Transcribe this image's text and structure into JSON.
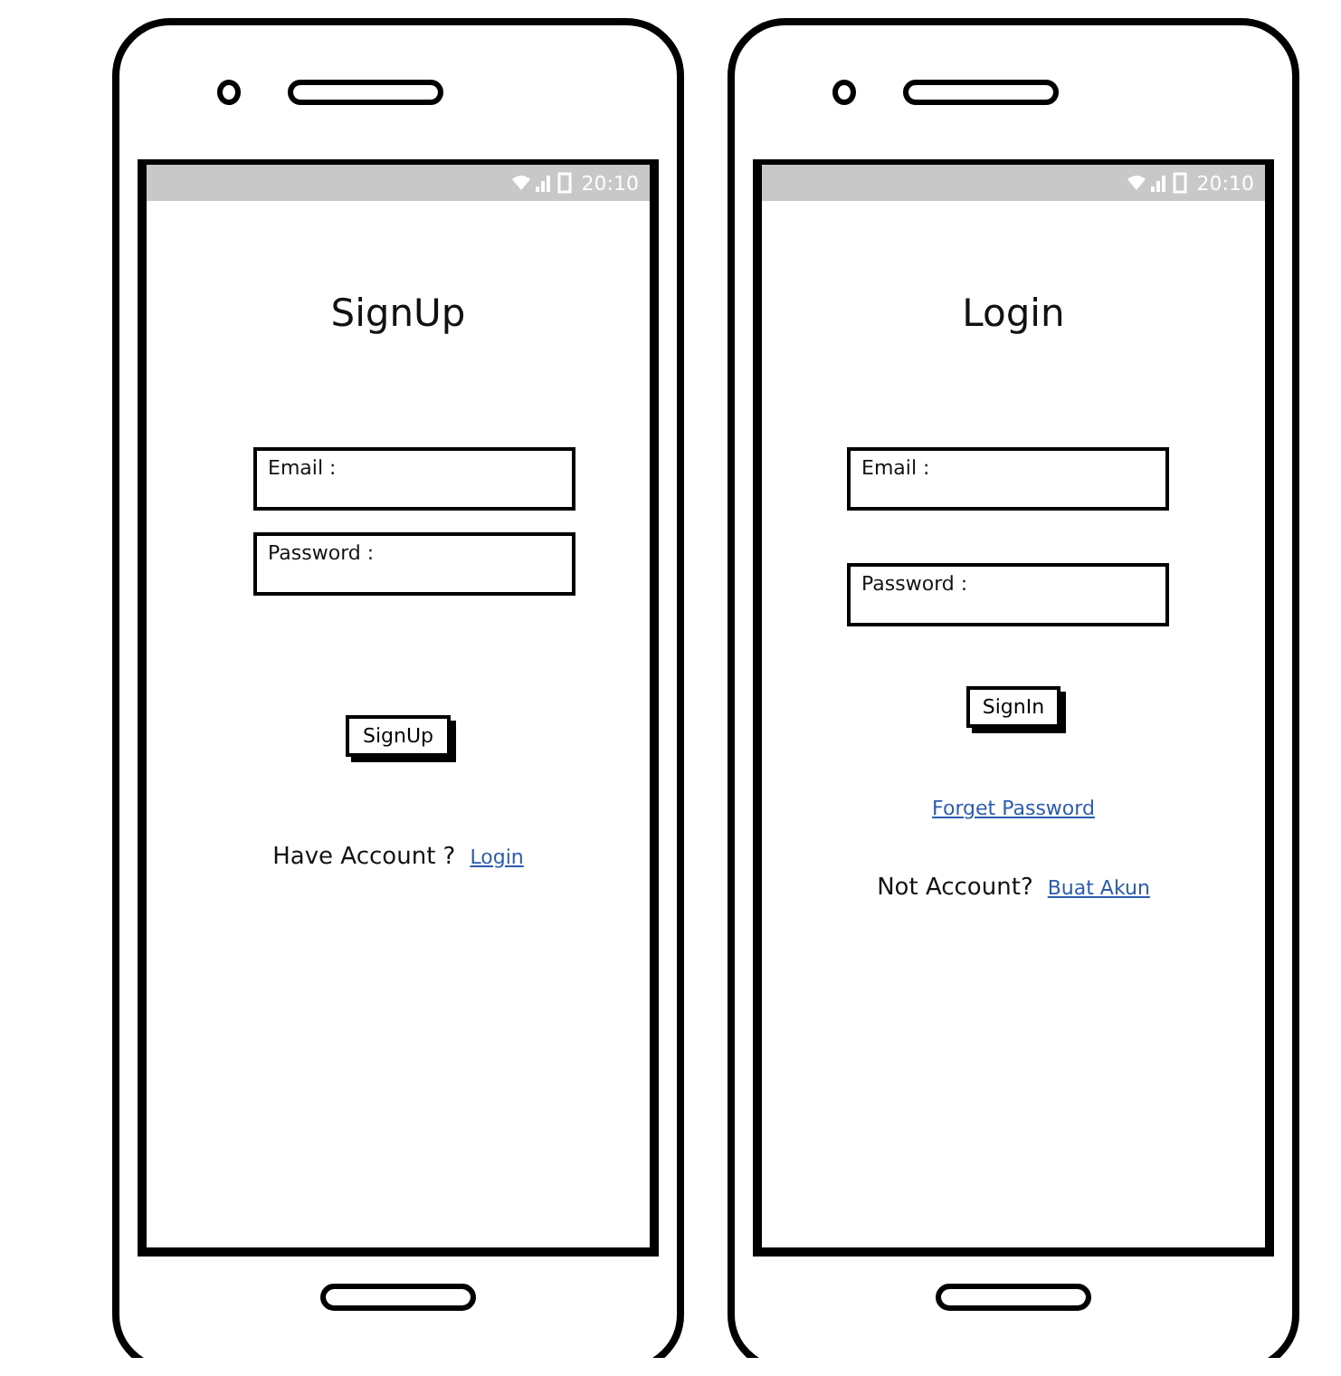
{
  "phones": [
    {
      "status_bar": {
        "time": "20:10"
      },
      "title": "SignUp",
      "fields": [
        {
          "placeholder": "Email :"
        },
        {
          "placeholder": "Password :"
        }
      ],
      "button": "SignUp",
      "links": [
        {
          "kind": "prompt",
          "text": "Have Account ?",
          "link": "Login"
        }
      ]
    },
    {
      "status_bar": {
        "time": "20:10"
      },
      "title": "Login",
      "fields": [
        {
          "placeholder": "Email :"
        },
        {
          "placeholder": "Password :"
        }
      ],
      "button": "SignIn",
      "links": [
        {
          "kind": "link",
          "link": "Forget Password"
        },
        {
          "kind": "prompt",
          "text": "Not Account?",
          "link": "Buat Akun"
        }
      ]
    }
  ]
}
